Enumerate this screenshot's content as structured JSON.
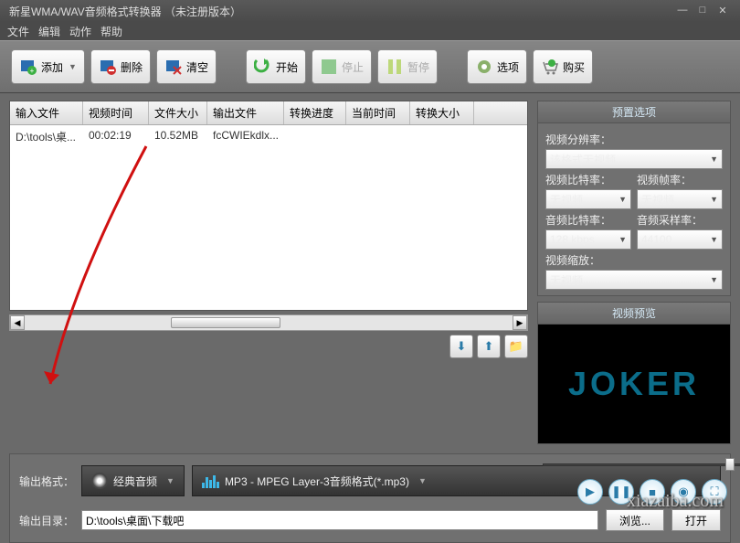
{
  "window": {
    "title": "新星WMA/WAV音频格式转换器  （未注册版本）"
  },
  "menu": {
    "file": "文件",
    "edit": "编辑",
    "action": "动作",
    "help": "帮助"
  },
  "toolbar": {
    "add": "添加",
    "delete": "删除",
    "clear": "清空",
    "start": "开始",
    "stop": "停止",
    "pause": "暂停",
    "options": "选项",
    "buy": "购买"
  },
  "table": {
    "headers": [
      "输入文件",
      "视频时间",
      "文件大小",
      "输出文件",
      "转换进度",
      "当前时间",
      "转换大小"
    ],
    "rows": [
      {
        "input": "D:\\tools\\桌...",
        "duration": "00:02:19",
        "size": "10.52MB",
        "output": "fcCWIEkdlx...",
        "progress": "",
        "time": "",
        "outsize": ""
      }
    ]
  },
  "presets": {
    "title": "预置选项",
    "resolution_label": "视频分辨率：",
    "resolution": "该格式无视频",
    "vbitrate_label": "视频比特率：",
    "vbitrate": "无视频",
    "vfps_label": "视频帧率：",
    "vfps": "无视频",
    "abitrate_label": "音频比特率：",
    "abitrate": "128 kbps",
    "asample_label": "音频采样率：",
    "asample": "44100",
    "vzoom_label": "视频缩放：",
    "vzoom": "无视频"
  },
  "preview": {
    "title": "视频预览",
    "logo": "JOKER"
  },
  "output": {
    "format_label": "输出格式：",
    "cat": "经典音频",
    "format": "MP3 - MPEG Layer-3音频格式(*.mp3)",
    "dir_label": "输出目录：",
    "dir": "D:\\tools\\桌面\\下载吧",
    "browse": "浏览...",
    "open": "打开"
  },
  "watermark": "xiazaiba.com"
}
